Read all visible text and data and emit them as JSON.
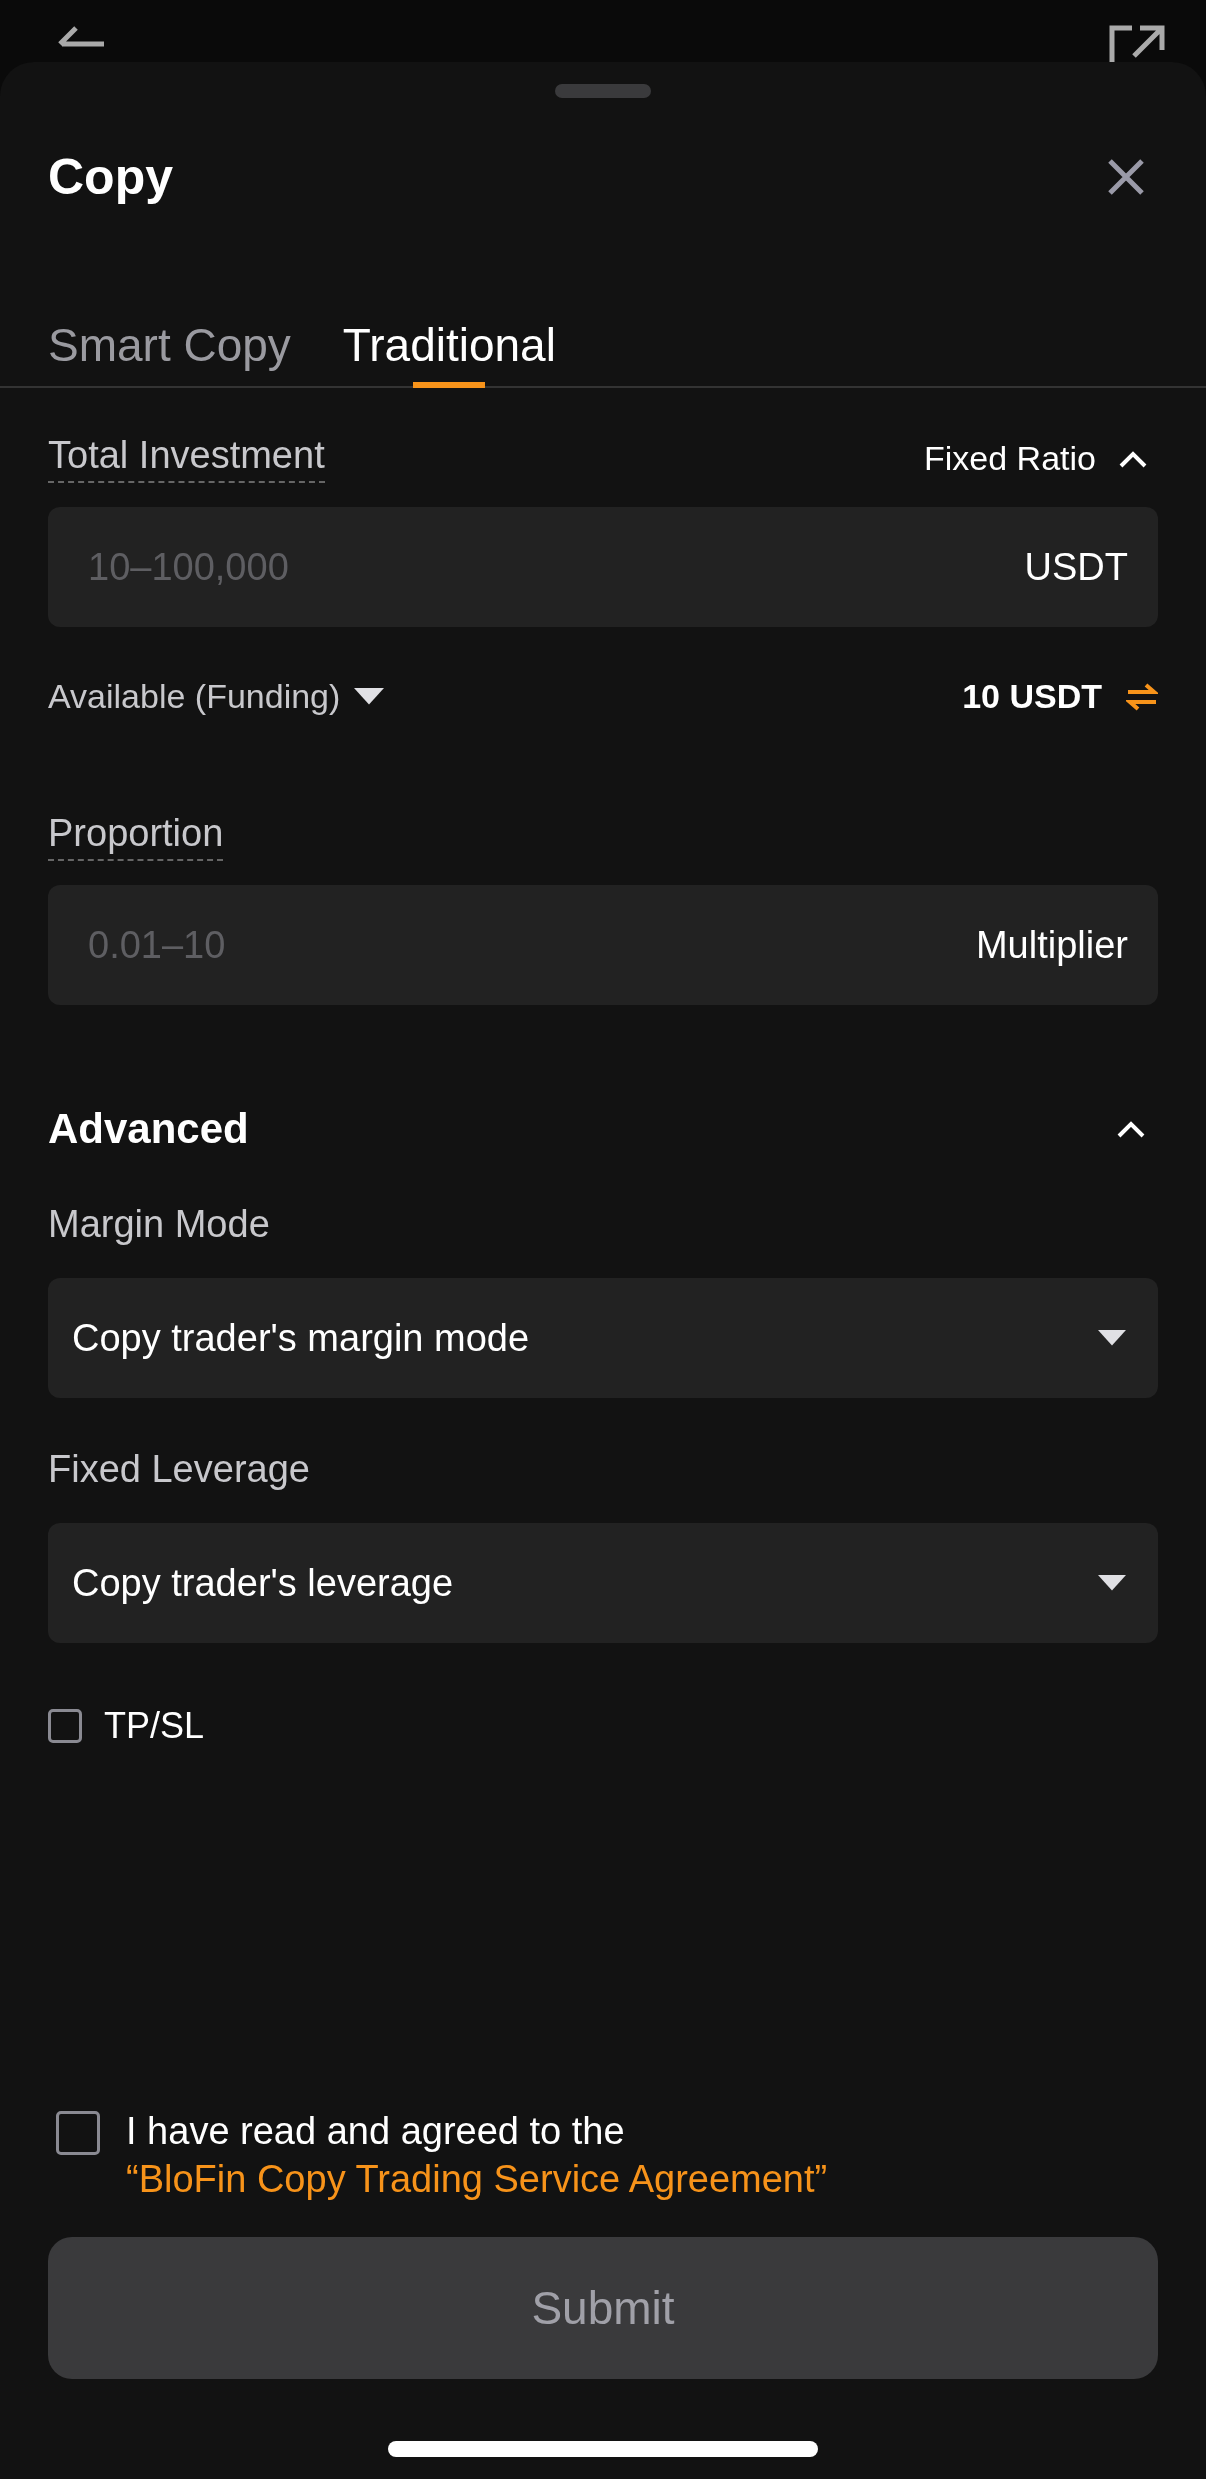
{
  "sheet": {
    "title": "Copy"
  },
  "tabs": [
    {
      "label": "Smart Copy",
      "selected": false
    },
    {
      "label": "Traditional",
      "selected": true
    }
  ],
  "investment": {
    "label": "Total Investment",
    "mode": "Fixed Ratio",
    "expanded": true,
    "placeholder": "10–100,000",
    "unit": "USDT"
  },
  "available": {
    "label": "Available (Funding)",
    "value": "10 USDT"
  },
  "proportion": {
    "label": "Proportion",
    "placeholder": "0.01–10",
    "unit": "Multiplier"
  },
  "advanced": {
    "title": "Advanced",
    "expanded": true,
    "selects": [
      {
        "label": "Margin Mode",
        "value": "Copy trader's margin mode"
      },
      {
        "label": "Fixed Leverage",
        "value": "Copy trader's leverage"
      }
    ],
    "tpsl": {
      "label": "TP/SL",
      "checked": false
    }
  },
  "agreement": {
    "text": "I have read and agreed to the",
    "link": "“BloFin Copy Trading Service Agreement”",
    "checked": false
  },
  "submit": {
    "label": "Submit",
    "disabled": true
  }
}
